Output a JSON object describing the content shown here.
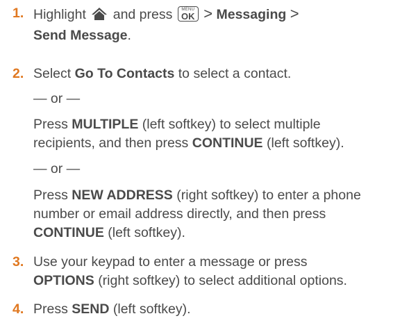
{
  "steps": [
    {
      "number": "1.",
      "parts": {
        "a": "Highlight",
        "b": "and press",
        "gt1": ">",
        "messaging": "Messaging",
        "gt2": ">",
        "send_message": "Send Message",
        "period": "."
      },
      "icons": [
        "home-icon",
        "menu-ok-key-icon"
      ],
      "key_label": {
        "menu": "MENU",
        "ok": "OK"
      }
    },
    {
      "number": "2.",
      "parts": {
        "select": "Select",
        "go_to_contacts": "Go To Contacts",
        "rest": "to select a contact."
      },
      "separator1": "— or —",
      "option_multiple": {
        "press": "Press",
        "multiple": "MULTIPLE",
        "line1_rest": "(left softkey) to select multiple",
        "line2_a": "recipients, and then press",
        "continue": "CONTINUE",
        "line2_rest": "(left softkey)."
      },
      "separator2": "— or —",
      "option_new_address": {
        "press": "Press",
        "new_address": "NEW ADDRESS",
        "line1_rest": "(right softkey) to enter a phone",
        "line2": "number or email address directly, and then press",
        "continue": "CONTINUE",
        "line3_rest": "(left softkey)."
      }
    },
    {
      "number": "3.",
      "parts": {
        "line1": "Use your keypad to enter a message or press",
        "options": "OPTIONS",
        "line2_rest": "(right softkey) to select additional options."
      }
    },
    {
      "number": "4.",
      "parts": {
        "press": "Press",
        "send": "SEND",
        "rest": "(left softkey)."
      }
    }
  ],
  "colors": {
    "step_number": "#e07820",
    "text": "#4a4a4a"
  }
}
